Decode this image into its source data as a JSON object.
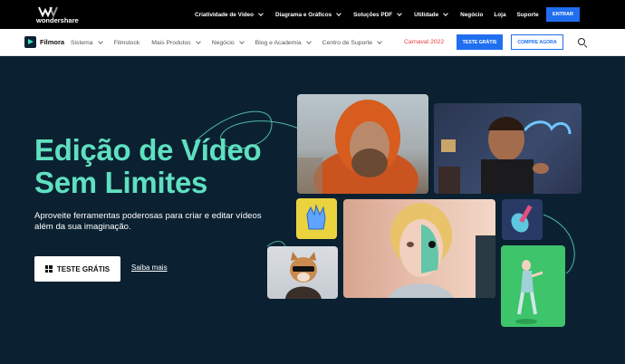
{
  "brand": {
    "name": "wondershare",
    "colors": {
      "accent": "#1f6ff0",
      "headline": "#5fe0c0",
      "hero_bg": "#0b2131",
      "promo": "#e83c3c"
    }
  },
  "topnav": {
    "items": [
      {
        "label": "Criatividade de Vídeo",
        "dropdown": true
      },
      {
        "label": "Diagrama e Gráficos",
        "dropdown": true
      },
      {
        "label": "Soluções PDF",
        "dropdown": true
      },
      {
        "label": "Utilidade",
        "dropdown": true
      },
      {
        "label": "Negócio",
        "dropdown": false
      },
      {
        "label": "Loja",
        "dropdown": false
      },
      {
        "label": "Suporte",
        "dropdown": false
      }
    ],
    "login_button": "ENTRAR"
  },
  "subnav": {
    "product": "Filmora",
    "items": [
      {
        "label": "Sistema",
        "dropdown": true
      },
      {
        "label": "Filmstock",
        "dropdown": false
      },
      {
        "label": "Mais Produtos",
        "dropdown": true
      },
      {
        "label": "Negócio",
        "dropdown": true
      },
      {
        "label": "Blog e Academia",
        "dropdown": true
      },
      {
        "label": "Centro de Suporte",
        "dropdown": true
      }
    ],
    "promo": "Carnaval 2022",
    "trial_button": "TESTE GRÁTIS",
    "buy_button": "COMPRE AGORA",
    "search_icon": "search-icon"
  },
  "hero": {
    "headline_line1": "Edição de Vídeo",
    "headline_line2": "Sem Limites",
    "subtitle_line1": "Aproveite ferramentas poderosas para criar e editar vídeos",
    "subtitle_line2": "além da sua imaginação.",
    "cta_label": "TESTE GRÁTIS",
    "cta_icon": "windows-icon",
    "more_link": "Saiba mais"
  }
}
